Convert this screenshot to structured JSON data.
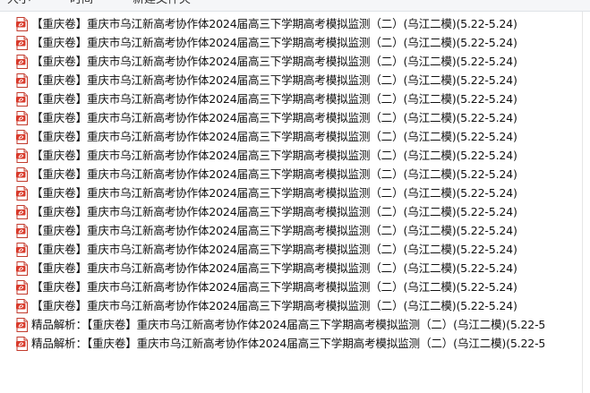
{
  "toolbar": {
    "items": [
      "大小",
      "时间",
      "新建文件夹"
    ]
  },
  "files": [
    {
      "icon": "pdf-file-icon",
      "name": "【重庆卷】重庆市乌江新高考协作体2024届高三下学期高考模拟监测（二）(乌江二模)(5.22-5.24)"
    },
    {
      "icon": "pdf-file-icon",
      "name": "【重庆卷】重庆市乌江新高考协作体2024届高三下学期高考模拟监测（二）(乌江二模)(5.22-5.24)"
    },
    {
      "icon": "pdf-file-icon",
      "name": "【重庆卷】重庆市乌江新高考协作体2024届高三下学期高考模拟监测（二）(乌江二模)(5.22-5.24)"
    },
    {
      "icon": "pdf-file-icon",
      "name": "【重庆卷】重庆市乌江新高考协作体2024届高三下学期高考模拟监测（二）(乌江二模)(5.22-5.24)"
    },
    {
      "icon": "pdf-file-icon",
      "name": "【重庆卷】重庆市乌江新高考协作体2024届高三下学期高考模拟监测（二）(乌江二模)(5.22-5.24)"
    },
    {
      "icon": "pdf-file-icon",
      "name": "【重庆卷】重庆市乌江新高考协作体2024届高三下学期高考模拟监测（二）(乌江二模)(5.22-5.24)"
    },
    {
      "icon": "pdf-file-icon",
      "name": "【重庆卷】重庆市乌江新高考协作体2024届高三下学期高考模拟监测（二）(乌江二模)(5.22-5.24)"
    },
    {
      "icon": "pdf-file-icon",
      "name": "【重庆卷】重庆市乌江新高考协作体2024届高三下学期高考模拟监测（二）(乌江二模)(5.22-5.24)"
    },
    {
      "icon": "pdf-file-icon",
      "name": "【重庆卷】重庆市乌江新高考协作体2024届高三下学期高考模拟监测（二）(乌江二模)(5.22-5.24)"
    },
    {
      "icon": "pdf-file-icon",
      "name": "【重庆卷】重庆市乌江新高考协作体2024届高三下学期高考模拟监测（二）(乌江二模)(5.22-5.24)"
    },
    {
      "icon": "pdf-file-icon",
      "name": "【重庆卷】重庆市乌江新高考协作体2024届高三下学期高考模拟监测（二）(乌江二模)(5.22-5.24)"
    },
    {
      "icon": "pdf-file-icon",
      "name": "【重庆卷】重庆市乌江新高考协作体2024届高三下学期高考模拟监测（二）(乌江二模)(5.22-5.24)"
    },
    {
      "icon": "pdf-file-icon",
      "name": "【重庆卷】重庆市乌江新高考协作体2024届高三下学期高考模拟监测（二）(乌江二模)(5.22-5.24)"
    },
    {
      "icon": "pdf-file-icon",
      "name": "【重庆卷】重庆市乌江新高考协作体2024届高三下学期高考模拟监测（二）(乌江二模)(5.22-5.24)"
    },
    {
      "icon": "pdf-file-icon",
      "name": "【重庆卷】重庆市乌江新高考协作体2024届高三下学期高考模拟监测（二）(乌江二模)(5.22-5.24)"
    },
    {
      "icon": "pdf-file-icon",
      "name": "【重庆卷】重庆市乌江新高考协作体2024届高三下学期高考模拟监测（二）(乌江二模)(5.22-5.24)"
    },
    {
      "icon": "pdf-file-icon",
      "name": "精品解析：【重庆卷】重庆市乌江新高考协作体2024届高三下学期高考模拟监测（二）(乌江二模)(5.22-5"
    },
    {
      "icon": "pdf-file-icon",
      "name": "精品解析：【重庆卷】重庆市乌江新高考协作体2024届高三下学期高考模拟监测（二）(乌江二模)(5.22-5"
    }
  ],
  "colors": {
    "pdf_red": "#d93a2b",
    "pdf_page": "#ffffff",
    "text": "#111111"
  }
}
